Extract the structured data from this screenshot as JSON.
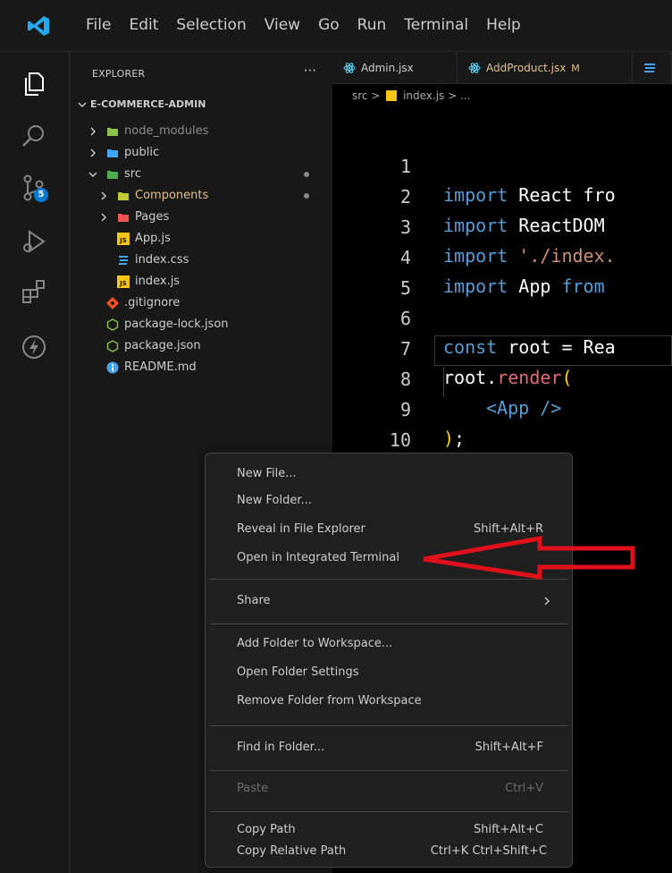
{
  "menubar": {
    "items": [
      "File",
      "Edit",
      "Selection",
      "View",
      "Go",
      "Run",
      "Terminal",
      "Help"
    ]
  },
  "activitybar": {
    "source_control_badge": "5",
    "accent": "#0078d4"
  },
  "sidebar": {
    "header": "EXPLORER",
    "more": "···",
    "workspace": "E-COMMERCE-ADMIN",
    "tree": [
      {
        "label": "node_modules",
        "icon": "node-folder-icon"
      },
      {
        "label": "public",
        "icon": "public-folder-icon"
      },
      {
        "label": "src",
        "icon": "src-folder-icon"
      },
      {
        "label": "Components",
        "icon": "components-folder-icon"
      },
      {
        "label": "Pages",
        "icon": "pages-folder-icon"
      },
      {
        "label": "App.js",
        "icon": "js-file-icon"
      },
      {
        "label": "index.css",
        "icon": "css-file-icon"
      },
      {
        "label": "index.js",
        "icon": "js-file-icon"
      },
      {
        "label": ".gitignore",
        "icon": "git-icon"
      },
      {
        "label": "package-lock.json",
        "icon": "npm-icon"
      },
      {
        "label": "package.json",
        "icon": "npm-icon"
      },
      {
        "label": "README.md",
        "icon": "info-icon"
      }
    ]
  },
  "tabs": [
    {
      "label": "Admin.jsx",
      "modified": ""
    },
    {
      "label": "AddProduct.jsx",
      "modified": "M"
    }
  ],
  "breadcrumb": {
    "folder": "src",
    "sep": ">",
    "file": "index.js",
    "tail": "> ..."
  },
  "code": {
    "line_numbers": [
      "1",
      "2",
      "3",
      "4",
      "5",
      "6",
      "7",
      "8",
      "9",
      "10"
    ],
    "l1_kw": "import",
    "l1_rest": " React fro",
    "l2_kw": "import",
    "l2_rest": " ReactDOM",
    "l3_kw": "import",
    "l3_rest": " './index.",
    "l4_kw": "import",
    "l4_id": " App ",
    "l4_from": "from",
    "l6_kw": "const",
    "l6_rest": " root = Rea",
    "l7_obj": "root",
    "l7_dot": ".",
    "l7_fn": "render",
    "l7_paren": "(",
    "l8_open": "<",
    "l8_comp": "App",
    "l8_close": " />",
    "l9_paren": ")",
    "l9_semi": ";"
  },
  "context_menu": {
    "new_file": "New File...",
    "new_folder": "New Folder...",
    "reveal": "Reveal in File Explorer",
    "reveal_kb": "Shift+Alt+R",
    "open_terminal": "Open in Integrated Terminal",
    "share": "Share",
    "add_folder": "Add Folder to Workspace...",
    "folder_settings": "Open Folder Settings",
    "remove_folder": "Remove Folder from Workspace",
    "find": "Find in Folder...",
    "find_kb": "Shift+Alt+F",
    "paste": "Paste",
    "paste_kb": "Ctrl+V",
    "copy_path": "Copy Path",
    "copy_path_kb": "Shift+Alt+C",
    "copy_rel": "Copy Relative Path",
    "copy_rel_kb": "Ctrl+K Ctrl+Shift+C"
  },
  "colors": {
    "annotation": "#e0101a",
    "editor_bg": "#000000",
    "sidebar_bg": "#181818"
  }
}
